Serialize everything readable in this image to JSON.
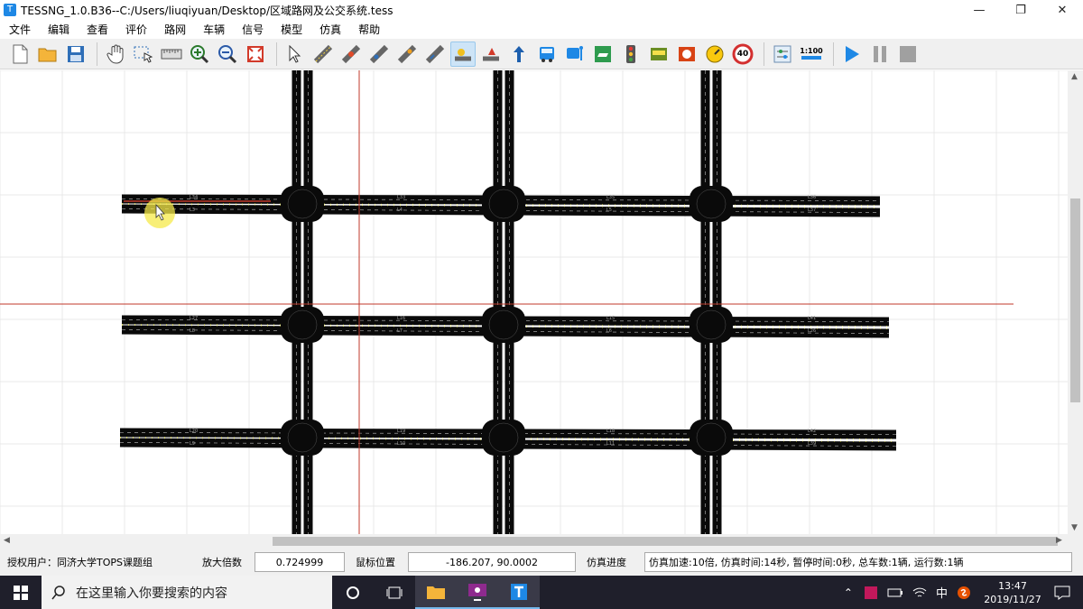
{
  "window": {
    "title": "TESSNG_1.0.B36--C:/Users/liuqiyuan/Desktop/区域路网及公交系统.tess",
    "app_icon": "T",
    "minimize": "—",
    "restore": "❐",
    "close": "✕"
  },
  "menu": [
    "文件",
    "编辑",
    "查看",
    "评价",
    "路网",
    "车辆",
    "信号",
    "模型",
    "仿真",
    "帮助"
  ],
  "toolbar": {
    "active_tool": "link-tool",
    "scale_label": "1:100",
    "speed_limit": "40"
  },
  "status": {
    "user_label": "授权用户：同济大学TOPS课题组",
    "zoom_label": "放大倍数",
    "zoom_value": "0.724999",
    "mouse_label": "鼠标位置",
    "mouse_value": "-186.207, 90.0002",
    "progress_label": "仿真进度",
    "progress_text": "仿真加速:10倍, 仿真时间:14秒, 暂停时间:0秒, 总车数:1辆, 运行数:1辆"
  },
  "taskbar": {
    "search_placeholder": "在这里输入你要搜索的内容",
    "ime": "中",
    "time": "13:47",
    "date": "2019/11/27"
  },
  "network": {
    "link_labels_h_top": [
      "L34",
      "L3",
      "L33",
      "L4",
      "L35",
      "L5",
      "L36",
      "L37"
    ],
    "link_labels_h_mid": [
      "L27",
      "L8",
      "L16",
      "L7",
      "L15",
      "L6",
      "L41",
      "L26"
    ],
    "link_labels_h_bot": [
      "L20",
      "L9",
      "L19",
      "L10",
      "L18",
      "L11",
      "L42",
      "L39"
    ],
    "colors": {
      "road": "#0a0a0a",
      "lane_line": "#bdbdbd",
      "crosshair": "#c0392b",
      "grid": "#e8e8e8",
      "edge_highlight": "#e8e64a"
    }
  }
}
